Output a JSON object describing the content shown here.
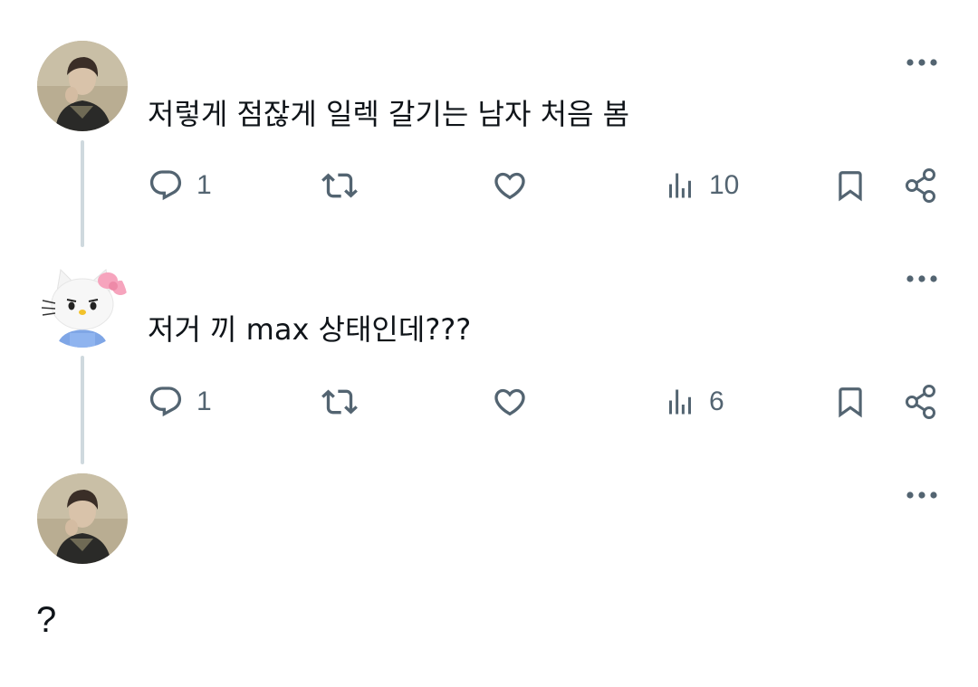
{
  "tweets": [
    {
      "author_avatar": "man-portrait-avatar",
      "text": "저렇게 점잖게 일렉 갈기는 남자 처음 봄",
      "replies": "1",
      "retweets": "",
      "likes": "",
      "views": "10"
    },
    {
      "author_avatar": "hello-kitty-avatar",
      "text": "저거 끼 max 상태인데???",
      "replies": "1",
      "retweets": "",
      "likes": "",
      "views": "6"
    },
    {
      "author_avatar": "man-portrait-avatar",
      "text": "?"
    }
  ],
  "icons": {
    "more": "more-dots-icon",
    "reply": "reply-bubble-icon",
    "retweet": "retweet-icon",
    "like": "heart-icon",
    "views": "views-bar-icon",
    "bookmark": "bookmark-icon",
    "share": "share-icon"
  },
  "colors": {
    "text": "#0f1419",
    "muted": "#536471",
    "thread_line": "#cfd9de",
    "background": "#ffffff"
  }
}
